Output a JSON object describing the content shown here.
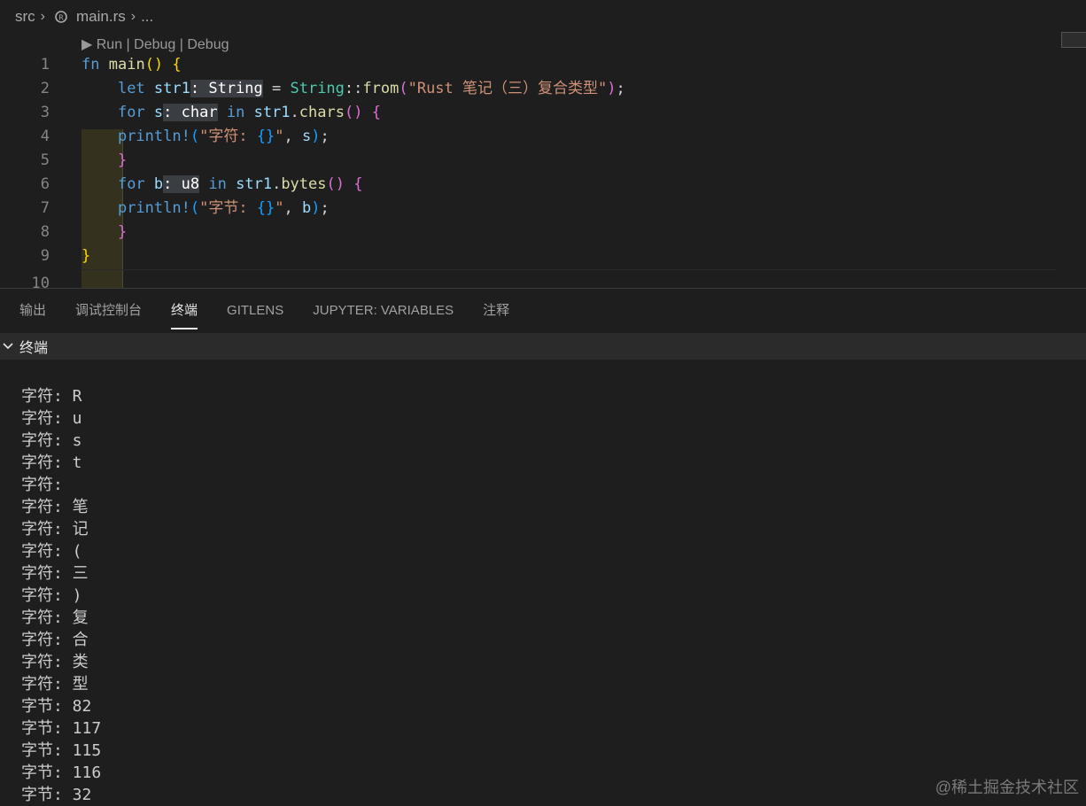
{
  "breadcrumb": {
    "folder": "src",
    "file": "main.rs",
    "more": "..."
  },
  "codelens": "▶ Run | Debug | Debug",
  "editor": {
    "line_numbers": [
      "1",
      "2",
      "3",
      "4",
      "5",
      "6",
      "7",
      "8",
      "9",
      "10"
    ]
  },
  "panel": {
    "tabs": [
      "输出",
      "调试控制台",
      "终端",
      "GITLENS",
      "JUPYTER: VARIABLES",
      "注释"
    ],
    "active_tab": "终端",
    "section_title": "终端"
  },
  "terminal_lines": [
    "字符: R",
    "字符: u",
    "字符: s",
    "字符: t",
    "字符:  ",
    "字符: 笔",
    "字符: 记",
    "字符: (",
    "字符: 三",
    "字符: )",
    "字符: 复",
    "字符: 合",
    "字符: 类",
    "字符: 型",
    "字节: 82",
    "字节: 117",
    "字节: 115",
    "字节: 116",
    "字节: 32"
  ],
  "watermark": "@稀土掘金技术社区",
  "colors": {
    "background": "#1e1e1e",
    "keyword": "#569cd6",
    "function": "#dcdcaa",
    "type": "#4ec9b0",
    "string": "#ce9178"
  }
}
